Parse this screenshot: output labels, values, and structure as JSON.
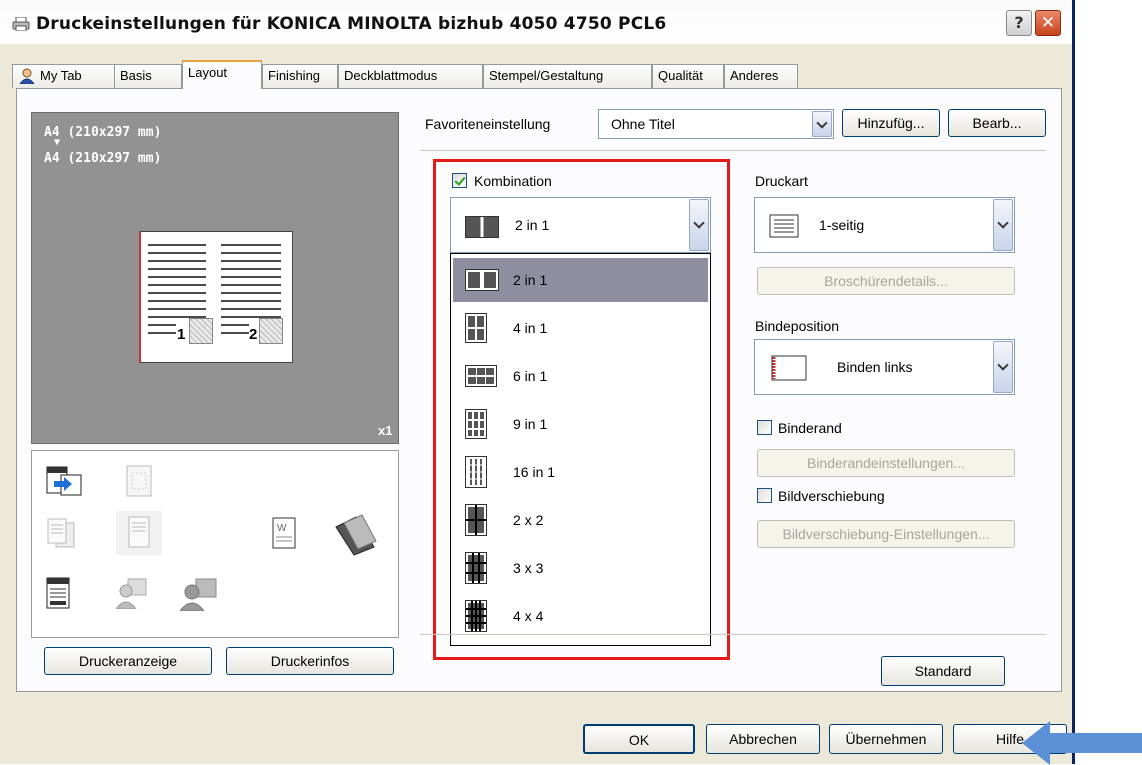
{
  "window": {
    "title": "Druckeinstellungen für KONICA MINOLTA bizhub 4050 4750 PCL6",
    "help_btn": "?",
    "close_btn": "✕"
  },
  "tabs": [
    "My Tab",
    "Basis",
    "Layout",
    "Finishing",
    "Deckblattmodus",
    "Stempel/Gestaltung",
    "Qualität",
    "Anderes"
  ],
  "active_tab": "Layout",
  "preview": {
    "source_size": "A4 (210x297 mm)",
    "arrow": "▼",
    "target_size": "A4 (210x297 mm)",
    "page1": "1",
    "page2": "2",
    "copies": "x1"
  },
  "left_buttons": {
    "printer_view": "Druckeranzeige",
    "printer_info": "Druckerinfos"
  },
  "favorites": {
    "label": "Favoriteneinstellung",
    "value": "Ohne Titel",
    "add_btn": "Hinzufüg...",
    "edit_btn": "Bearb..."
  },
  "combination": {
    "checkbox_label": "Kombination",
    "checked": true,
    "selected": "2 in 1",
    "options": [
      "2 in 1",
      "4 in 1",
      "6 in 1",
      "9 in 1",
      "16 in 1",
      "2 x 2",
      "3 x 3",
      "4 x 4"
    ]
  },
  "print_type": {
    "label": "Druckart",
    "value": "1-seitig",
    "booklet_btn": "Broschürendetails..."
  },
  "binding": {
    "label": "Bindeposition",
    "value": "Binden links"
  },
  "margin": {
    "checkbox_label": "Binderand",
    "checked": false,
    "settings_btn": "Binderandeinstellungen..."
  },
  "shift": {
    "checkbox_label": "Bildverschiebung",
    "checked": false,
    "settings_btn": "Bildverschiebung-Einstellungen..."
  },
  "standard_btn": "Standard",
  "bottom_buttons": {
    "ok": "OK",
    "cancel": "Abbrechen",
    "apply": "Übernehmen",
    "help": "Hilfe"
  },
  "colors": {
    "highlight_box": "#e41919",
    "annotation_arrow": "#5b8fd6",
    "selected_item": "#8e8ea0"
  }
}
